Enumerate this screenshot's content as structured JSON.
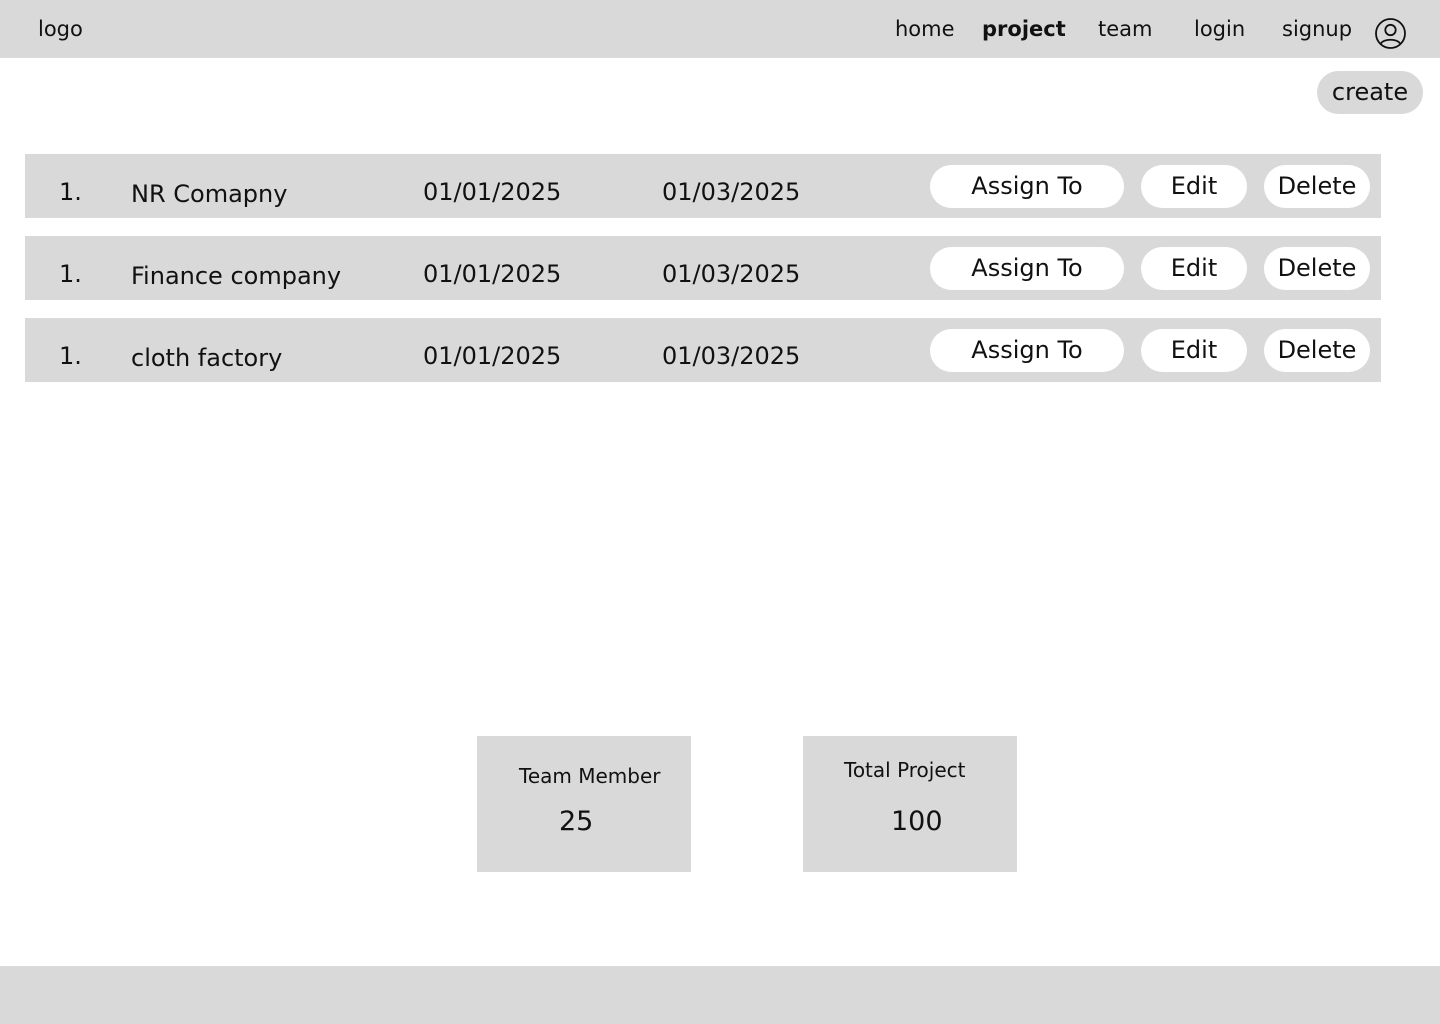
{
  "header": {
    "logo": "logo",
    "nav": {
      "home": "home",
      "project": "project",
      "team": "team",
      "login": "login",
      "signup": "signup"
    },
    "active_nav": "project",
    "avatar_icon": "user-circle-icon"
  },
  "toolbar": {
    "create_label": "create"
  },
  "projects": [
    {
      "index": "1.",
      "name": "NR Comapny",
      "start_date": "01/01/2025",
      "end_date": "01/03/2025"
    },
    {
      "index": "1.",
      "name": "Finance company",
      "start_date": "01/01/2025",
      "end_date": "01/03/2025"
    },
    {
      "index": "1.",
      "name": "cloth factory",
      "start_date": "01/01/2025",
      "end_date": "01/03/2025"
    }
  ],
  "row_actions": {
    "assign": "Assign To",
    "edit": "Edit",
    "delete": "Delete"
  },
  "stats": {
    "team_members": {
      "label": "Team Member",
      "value": "25"
    },
    "total_projects": {
      "label": "Total Project",
      "value": "100"
    }
  },
  "colors": {
    "panel_gray": "#d9d9d9",
    "button_white": "#ffffff",
    "text": "#111111"
  }
}
